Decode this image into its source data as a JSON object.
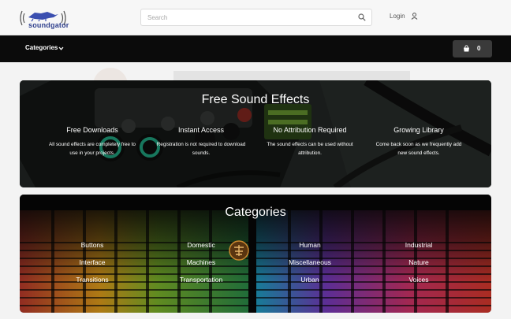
{
  "header": {
    "logo_text": "soundgator",
    "search_placeholder": "Search",
    "login_label": "Login"
  },
  "nav": {
    "categories_label": "Categories",
    "cart_count": "0"
  },
  "hero": {
    "title": "Free Sound Effects",
    "features": [
      {
        "title": "Free Downloads",
        "text": "All sound effects are completely free to use in your projects."
      },
      {
        "title": "Instant Access",
        "text": "Registration is not required to download sounds."
      },
      {
        "title": "No Attribution Required",
        "text": "The sound effects can be used without attribution."
      },
      {
        "title": "Growing Library",
        "text": "Come back soon as we frequently add new sound effects."
      }
    ]
  },
  "categories": {
    "title": "Categories",
    "items": [
      "Buttons",
      "Domestic",
      "Human",
      "Industrial",
      "Interface",
      "Machines",
      "Miscellaneous",
      "Nature",
      "Transitions",
      "Transportation",
      "Urban",
      "Voices"
    ]
  },
  "icons": {
    "search": "search-icon",
    "user": "user-icon",
    "chevron": "chevron-down-icon",
    "cart": "cart-icon"
  },
  "colors": {
    "logo_blue": "#2d3e8c",
    "nav_bg": "#0b0b0b",
    "cart_bg": "#3a3a3a"
  }
}
